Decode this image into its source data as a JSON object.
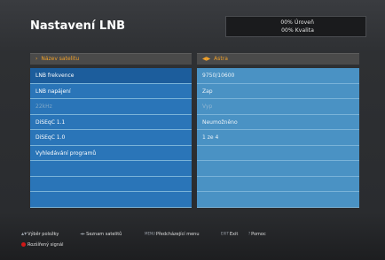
{
  "header": {
    "title": "Nastavení LNB",
    "signal_level": "00% Úroveň",
    "signal_quality": "00% Kvalita"
  },
  "left_column": {
    "header": "Název satelitu",
    "items": [
      {
        "label": "LNB frekvence"
      },
      {
        "label": "LNB napájení"
      },
      {
        "label": "22kHz"
      },
      {
        "label": "DiSEqC 1.1"
      },
      {
        "label": "DiSEqC 1.0"
      },
      {
        "label": "Vyhledávání programů"
      },
      {
        "label": ""
      },
      {
        "label": ""
      },
      {
        "label": ""
      },
      {
        "label": ""
      }
    ]
  },
  "right_column": {
    "header": "Astra",
    "items": [
      {
        "value": "9750/10600"
      },
      {
        "value": "Zap"
      },
      {
        "value": "Vyp"
      },
      {
        "value": "Neumožněno"
      },
      {
        "value": "1 ze 4"
      },
      {
        "value": ""
      },
      {
        "value": ""
      },
      {
        "value": ""
      },
      {
        "value": ""
      },
      {
        "value": ""
      }
    ]
  },
  "footer": {
    "items": [
      {
        "key": "▲▼",
        "label": "Výběr položky"
      },
      {
        "key": "◄►",
        "label": "Seznam satelitů"
      },
      {
        "key": "MENU",
        "label": "Předcházející menu"
      },
      {
        "key": "EXIT",
        "label": "Exit"
      },
      {
        "key": "?",
        "label": "Pomoc"
      }
    ],
    "extra": "Rozšířený signál"
  },
  "colors": {
    "accent": "#f1a12a",
    "left_row": "#2a75b8",
    "right_row": "#4a92c4",
    "red_key": "#d01818"
  }
}
